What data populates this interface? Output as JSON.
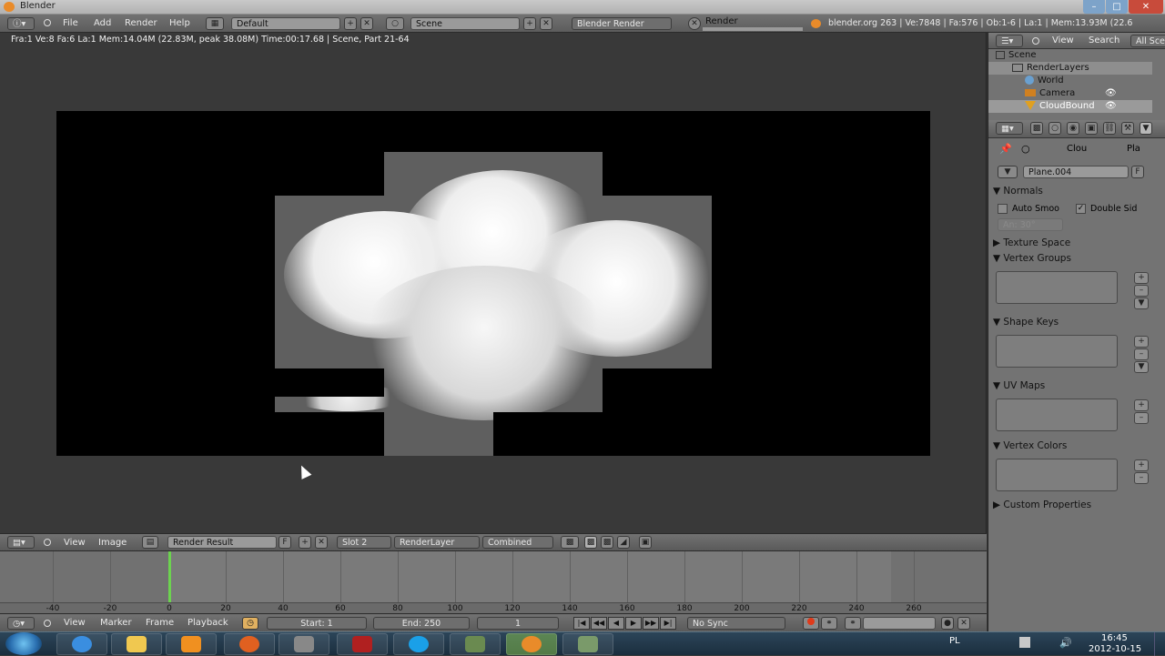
{
  "window": {
    "title": "Blender"
  },
  "info_header": {
    "menus": [
      "File",
      "Add",
      "Render",
      "Help"
    ],
    "layout": "Default",
    "scene": "Scene",
    "engine": "Blender Render",
    "render_label": "Render",
    "stats": "blender.org 263 | Ve:7848 | Fa:576 | Ob:1-6 | La:1 | Mem:13.93M (22.6"
  },
  "render": {
    "info": "Fra:1  Ve:8 Fa:6 La:1 Mem:14.04M (22.83M, peak 38.08M) Time:00:17.68 | Scene, Part 21-64"
  },
  "image_header": {
    "menus": [
      "View",
      "Image"
    ],
    "image_name": "Render Result",
    "fake_user": "F",
    "slot": "Slot 2",
    "layer": "RenderLayer",
    "pass": "Combined"
  },
  "timeline": {
    "ticks": [
      "-40",
      "-20",
      "0",
      "20",
      "40",
      "60",
      "80",
      "100",
      "120",
      "140",
      "160",
      "180",
      "200",
      "220",
      "240",
      "260"
    ],
    "current_frame": 0,
    "menus": [
      "View",
      "Marker",
      "Frame",
      "Playback"
    ],
    "start": "Start: 1",
    "end": "End: 250",
    "frame": "1",
    "sync": "No Sync"
  },
  "outliner": {
    "menus": [
      "View",
      "Search"
    ],
    "filter": "All Scenes",
    "rows": [
      "Scene",
      "RenderLayers",
      "World",
      "Camera",
      "CloudBound"
    ]
  },
  "properties": {
    "breadcrumb": [
      "Clou",
      "Pla"
    ],
    "mesh_name": "Plane.004",
    "fake_user": "F",
    "panels": {
      "normals": "Normals",
      "auto_smooth": "Auto Smoo",
      "double_sided": "Double Sid",
      "angle": "An: 30°",
      "texture_space": "Texture Space",
      "vertex_groups": "Vertex Groups",
      "shape_keys": "Shape Keys",
      "uv_maps": "UV Maps",
      "vertex_colors": "Vertex Colors",
      "custom_properties": "Custom Properties"
    }
  },
  "taskbar": {
    "lang": "PL",
    "time": "16:45",
    "date": "2012-10-15"
  },
  "colors": {
    "timeline_cursor": "#6cd34f",
    "accent": "#e98b2a"
  }
}
